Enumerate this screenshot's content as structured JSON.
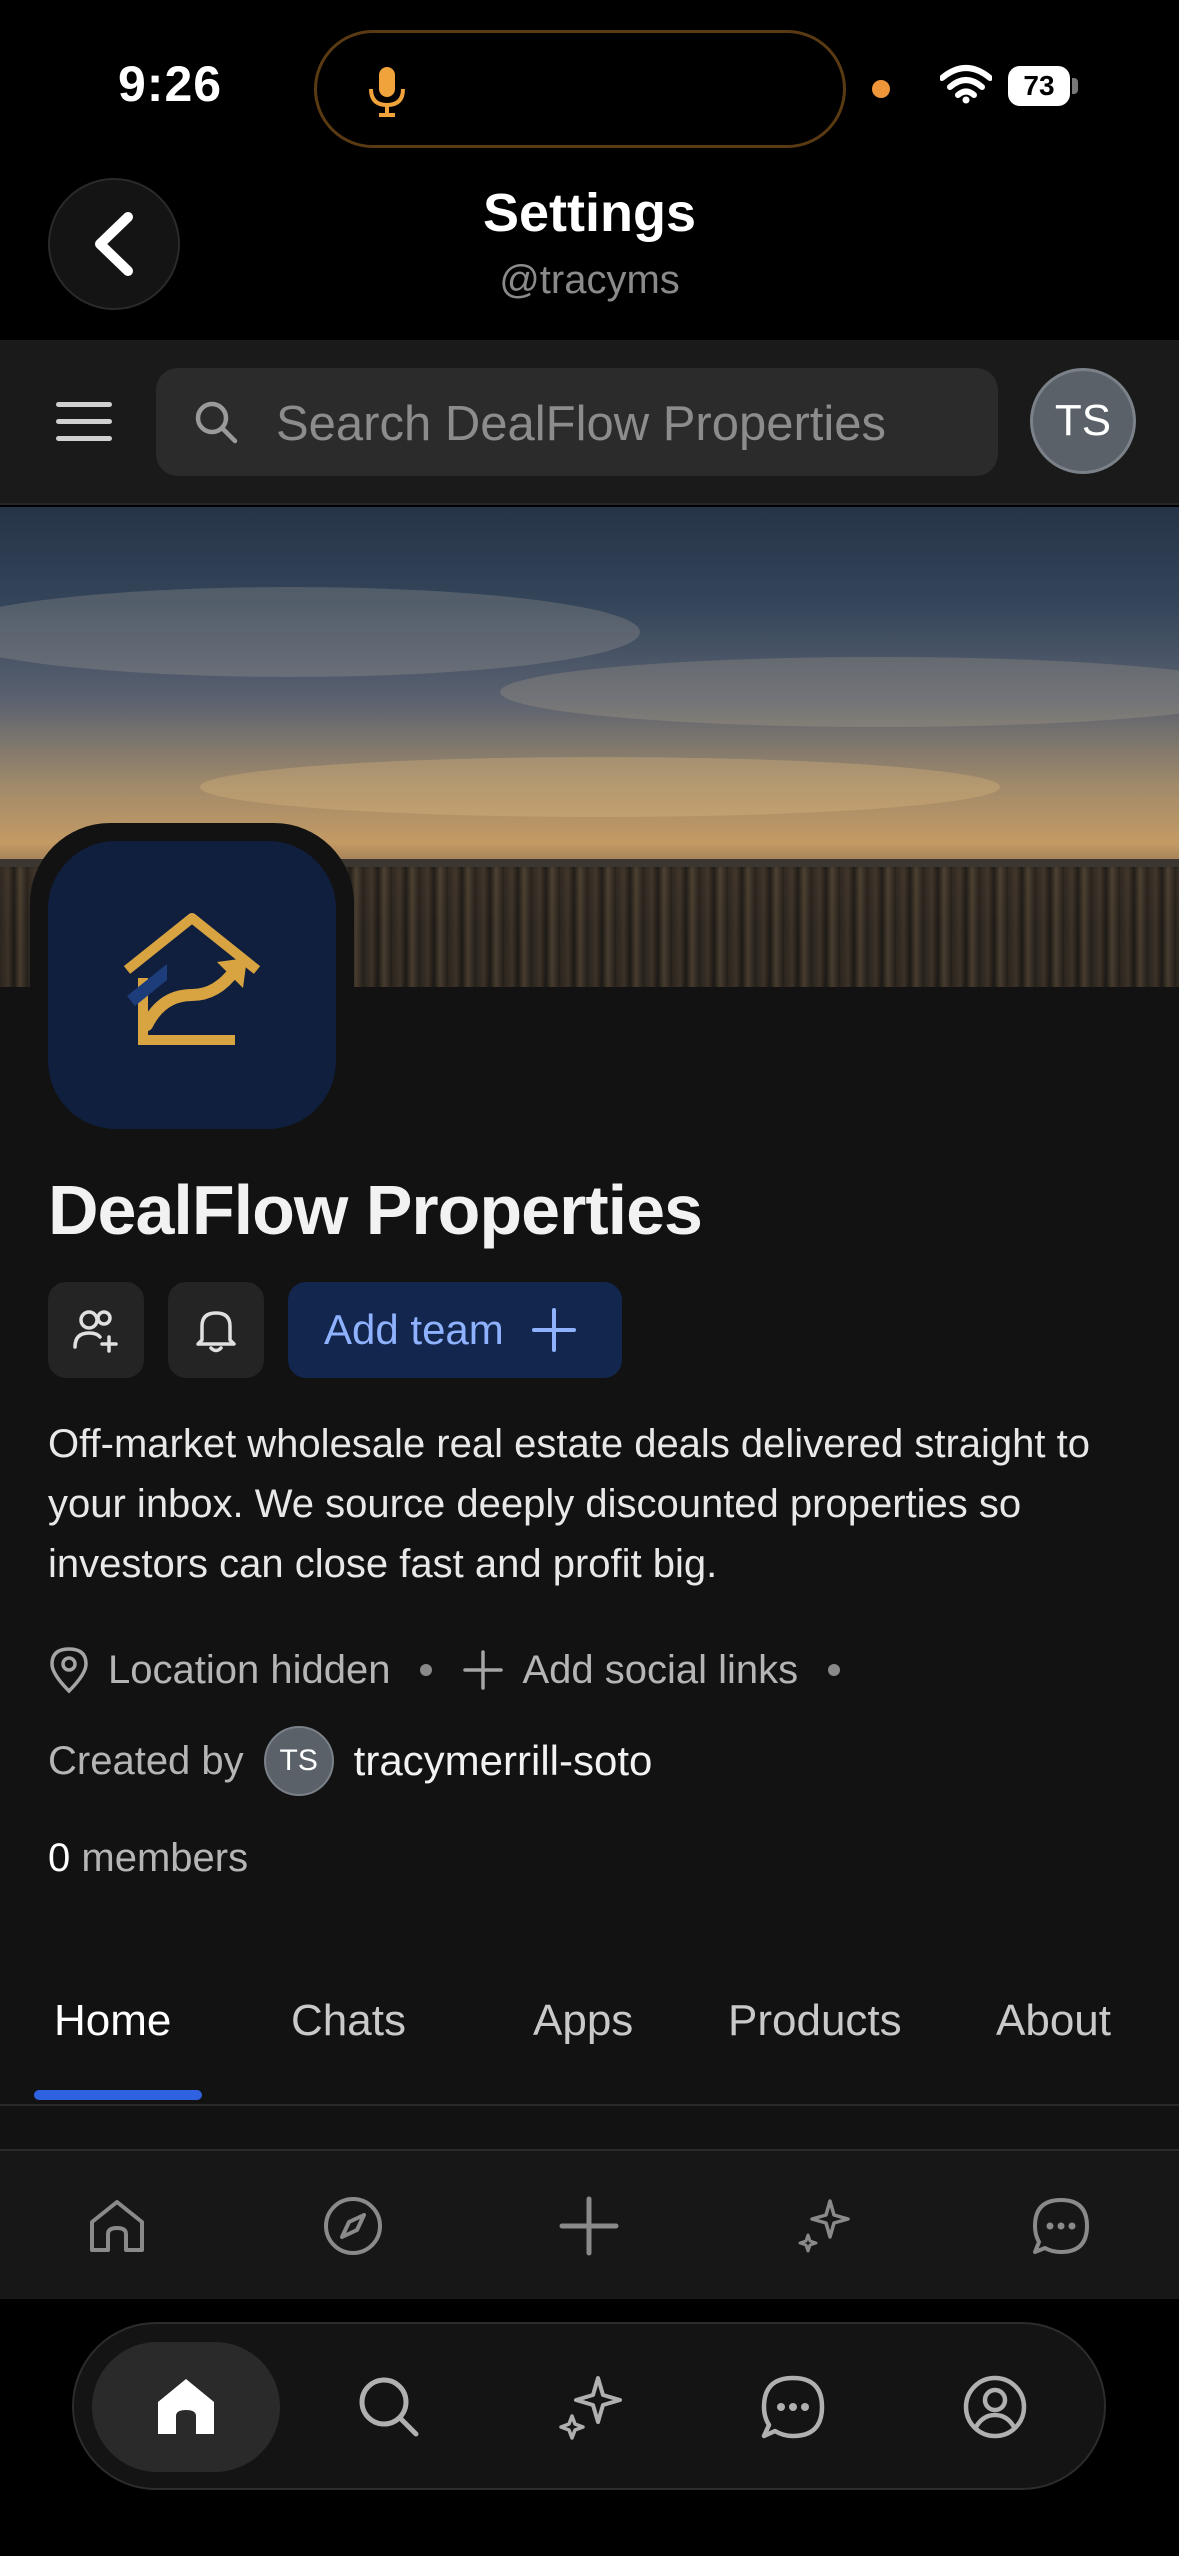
{
  "status_bar": {
    "time": "9:26",
    "battery": "73"
  },
  "header": {
    "title": "Settings",
    "subtitle": "@tracyms"
  },
  "search": {
    "placeholder": "Search DealFlow Properties",
    "avatar_initials": "TS"
  },
  "company": {
    "name": "DealFlow Properties",
    "add_team_label": "Add team",
    "description": "Off-market wholesale real estate deals delivered straight to your inbox. We source deeply discounted properties so investors can close fast and profit big.",
    "location": "Location hidden",
    "add_social_links": "Add social links",
    "created_by_label": "Created by",
    "creator_initials": "TS",
    "creator_name": "tracymerrill-soto",
    "member_count": "0",
    "members_label": "members"
  },
  "tabs": [
    {
      "label": "Home",
      "active": true
    },
    {
      "label": "Chats",
      "active": false
    },
    {
      "label": "Apps",
      "active": false
    },
    {
      "label": "Products",
      "active": false
    },
    {
      "label": "About",
      "active": false
    }
  ],
  "web_nav_icons": [
    "home-icon",
    "compass-icon",
    "plus-icon",
    "sparkle-icon",
    "chat-icon"
  ],
  "app_tabbar_icons": [
    "home-icon",
    "search-icon",
    "sparkle-icon",
    "chat-icon",
    "profile-icon"
  ],
  "colors": {
    "accent": "#2f62e0",
    "add_team_bg": "#13264e",
    "add_team_text": "#8fb2ff",
    "logo_bg": "#0f1f3d",
    "logo_gold": "#d7a441"
  }
}
